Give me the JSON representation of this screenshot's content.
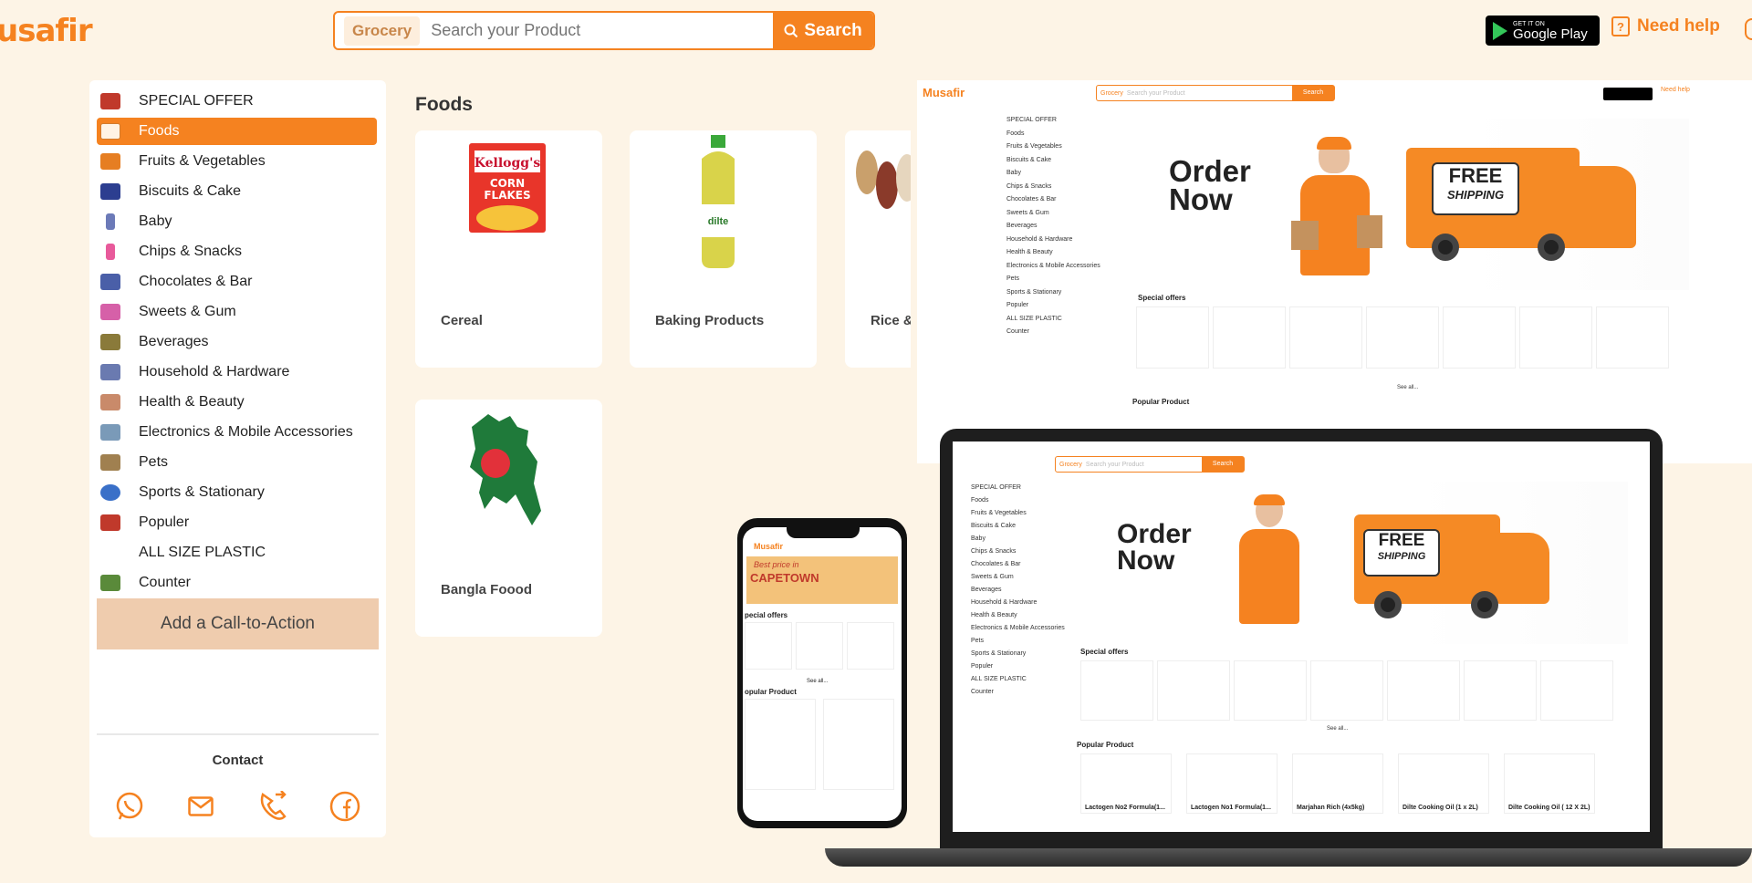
{
  "header": {
    "logo": "usafir",
    "search": {
      "category": "Grocery",
      "placeholder": "Search your Product",
      "button": "Search"
    },
    "gplay": {
      "line1": "GET IT ON",
      "line2": "Google Play"
    },
    "help": "Need help"
  },
  "sidebar": {
    "items": [
      {
        "label": "SPECIAL OFFER",
        "icon": "special-offer-icon",
        "color": "#c0392b"
      },
      {
        "label": "Foods",
        "icon": "foods-icon",
        "color": "#f58220",
        "active": true
      },
      {
        "label": "Fruits & Vegetables",
        "icon": "fruits-icon",
        "color": "#e67e22"
      },
      {
        "label": "Biscuits & Cake",
        "icon": "biscuit-icon",
        "color": "#2c3e90"
      },
      {
        "label": "Baby",
        "icon": "baby-icon",
        "color": "#6c7ab8"
      },
      {
        "label": "Chips & Snacks",
        "icon": "chips-icon",
        "color": "#e85a9b"
      },
      {
        "label": "Chocolates & Bar",
        "icon": "chocolate-icon",
        "color": "#4a5fa8"
      },
      {
        "label": "Sweets & Gum",
        "icon": "sweets-icon",
        "color": "#d660a8"
      },
      {
        "label": "Beverages",
        "icon": "beverages-icon",
        "color": "#8a7a3a"
      },
      {
        "label": "Household & Hardware",
        "icon": "household-icon",
        "color": "#6a7ab0"
      },
      {
        "label": "Health & Beauty",
        "icon": "health-icon",
        "color": "#c98a6a"
      },
      {
        "label": "Electronics & Mobile Accessories",
        "icon": "electronics-icon",
        "color": "#7a9ab8"
      },
      {
        "label": "Pets",
        "icon": "pets-icon",
        "color": "#a08050"
      },
      {
        "label": "Sports & Stationary",
        "icon": "sports-icon",
        "color": "#3a70c8"
      },
      {
        "label": "Populer",
        "icon": "populer-icon",
        "color": "#c0392b"
      },
      {
        "label": "ALL SIZE PLASTIC",
        "icon": "",
        "color": ""
      },
      {
        "label": "Counter",
        "icon": "counter-icon",
        "color": "#5a8a3a"
      }
    ],
    "cta": "Add a Call-to-Action",
    "contact": "Contact"
  },
  "foods": {
    "title": "Foods",
    "categories": [
      {
        "name": "Cereal"
      },
      {
        "name": "Baking Products"
      },
      {
        "name": "Rice &"
      },
      {
        "name": "Bangla Foood"
      }
    ]
  },
  "mockup": {
    "logo": "Musafir",
    "banner_title_1": "Order",
    "banner_title_2": "Now",
    "free": "FREE",
    "shipping": "SHIPPING",
    "special_offers": "Special offers",
    "popular_product": "Popular Product",
    "see_all": "See all...",
    "phone_banner": "Best price in",
    "phone_city": "CAPETOWN",
    "phone_special": "pecial offers",
    "phone_popular": "opular Product",
    "laptop_products": [
      "Lactogen No2 Formula(1...",
      "Lactogen No1 Formula(1...",
      "Marjahan Rich (4x5kg)",
      "Dilte Cooking Oil (1 x 2L)",
      "Dilte Cooking Oil ( 12 X 2L)"
    ]
  },
  "colors": {
    "accent": "#f58220",
    "background": "#fdf4e6",
    "cta": "#efccae"
  }
}
